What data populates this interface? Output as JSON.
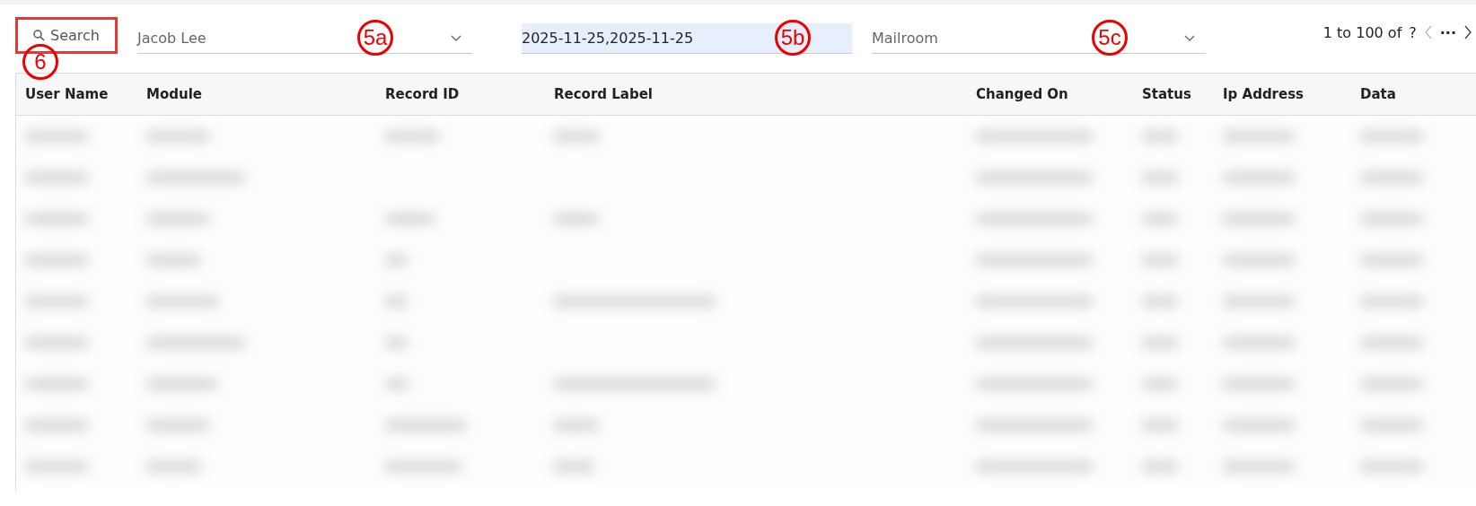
{
  "toolbar": {
    "search": {
      "label": "Search",
      "highlighted": true,
      "callout": "6"
    },
    "filters": [
      {
        "kind": "dropdown",
        "value": "Jacob Lee",
        "callout": "5a"
      },
      {
        "kind": "date",
        "value": "2025-11-25,2025-11-25",
        "callout": "5b"
      },
      {
        "kind": "dropdown",
        "value": "Mailroom",
        "callout": "5c"
      }
    ],
    "pagination": {
      "range": "1 to 100 of",
      "total": "?",
      "more": "···"
    }
  },
  "table": {
    "columns": [
      "User Name",
      "Module",
      "Record ID",
      "Record Label",
      "Changed On",
      "Status",
      "Ip Address",
      "Data"
    ],
    "rows": [
      {
        "redacted": true
      },
      {
        "redacted": true
      },
      {
        "redacted": true
      },
      {
        "redacted": true
      },
      {
        "redacted": true
      },
      {
        "redacted": true
      },
      {
        "redacted": true
      },
      {
        "redacted": true
      },
      {
        "redacted": true
      }
    ]
  }
}
